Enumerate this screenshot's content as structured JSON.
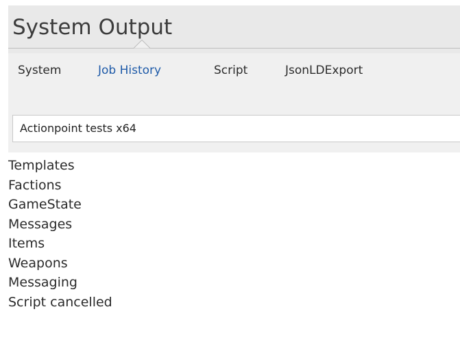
{
  "window": {
    "title": "System Output"
  },
  "tabs": [
    {
      "label": "System",
      "active": false
    },
    {
      "label": "Job History",
      "active": true
    },
    {
      "label": "Script",
      "active": false
    },
    {
      "label": "JsonLDExport",
      "active": false
    }
  ],
  "job_selector": {
    "value": "Actionpoint tests x64"
  },
  "output_lines": [
    "Templates",
    "Factions",
    "GameState",
    "Messages",
    "Items",
    "Weapons",
    "Messaging",
    "Script cancelled"
  ],
  "colors": {
    "header_background": "#f0f0f0",
    "active_tab": "#1e5aa8",
    "text": "#2a2a2a"
  }
}
